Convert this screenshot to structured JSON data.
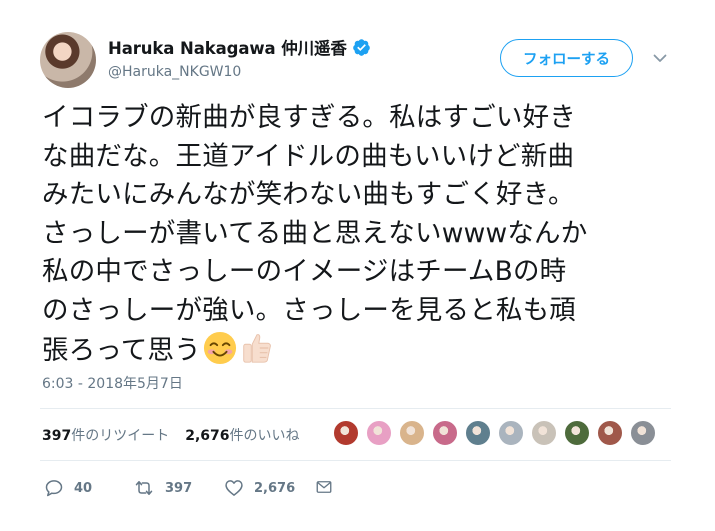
{
  "user": {
    "display_name": "Haruka Nakagawa 仲川遥香",
    "handle": "@Haruka_NKGW10",
    "verified_icon": "verified-badge-icon"
  },
  "follow_button": {
    "label": "フォローする"
  },
  "tweet": {
    "lines": [
      "イコラブの新曲が良すぎる。私はすごい好き",
      "な曲だな。王道アイドルの曲もいいけど新曲",
      "みたいにみんなが笑わない曲もすごく好き。",
      "さっしーが書いてる曲と思えないwwwなんか",
      "私の中でさっしーのイメージはチームBの時",
      "のさっしーが強い。さっしーを見ると私も頑",
      "張ろって思う"
    ],
    "emojis": [
      "smiling-face-icon",
      "thumbs-up-icon"
    ],
    "timestamp": "6:03 - 2018年5月7日"
  },
  "stats": {
    "retweets_count": "397",
    "retweets_label": "件のリツイート",
    "likes_count": "2,676",
    "likes_label": "件のいいね"
  },
  "likers": [
    "#b23a2e",
    "#e8a0c4",
    "#d9b48c",
    "#c86a8a",
    "#5f7f8e",
    "#aab4be",
    "#c9c2b8",
    "#4e6b3c",
    "#a0584a",
    "#8a8f96"
  ],
  "actions": {
    "reply_count": "40",
    "retweet_count": "397",
    "like_count": "2,676"
  },
  "colors": {
    "accent": "#1da1f2",
    "text": "#14171a",
    "secondary": "#657786",
    "divider": "#e6ecf0"
  }
}
